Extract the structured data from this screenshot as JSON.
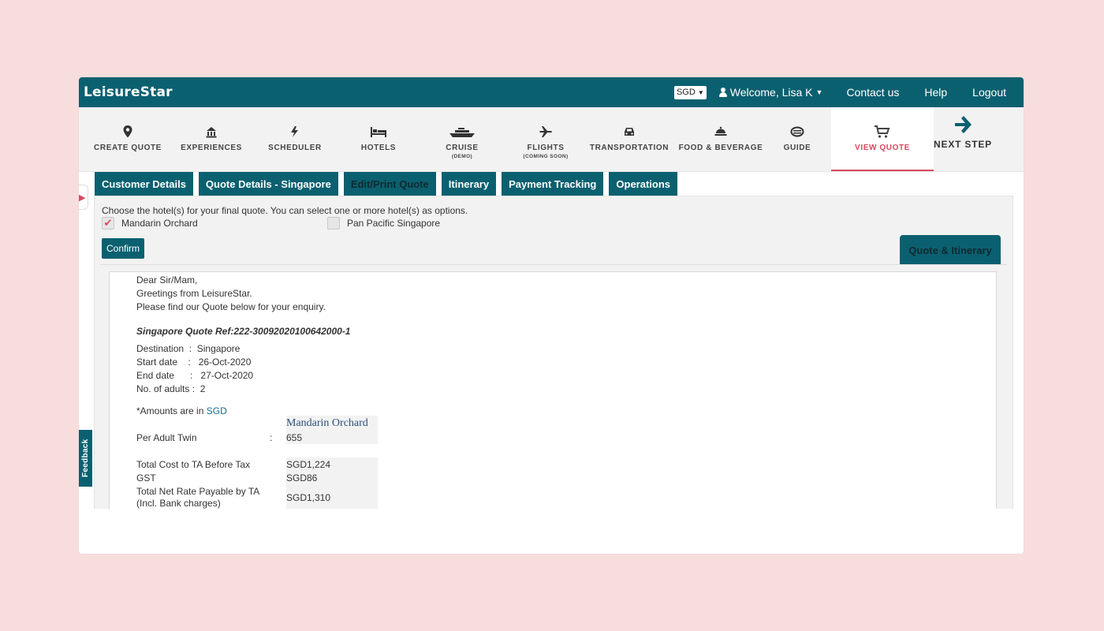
{
  "header": {
    "brand": "LeisureStar",
    "currency": "SGD",
    "welcome": "Welcome, Lisa K",
    "links": [
      "Contact us",
      "Help",
      "Logout"
    ]
  },
  "nav": {
    "items": [
      {
        "label": "CREATE QUOTE",
        "sub": "",
        "icon": "map-pin-icon"
      },
      {
        "label": "EXPERIENCES",
        "sub": "",
        "icon": "landmark-icon"
      },
      {
        "label": "SCHEDULER",
        "sub": "",
        "icon": "bolt-icon"
      },
      {
        "label": "HOTELS",
        "sub": "",
        "icon": "bed-icon"
      },
      {
        "label": "CRUISE",
        "sub": "(DEMO)",
        "icon": "ship-icon"
      },
      {
        "label": "FLIGHTS",
        "sub": "(COMING SOON)",
        "icon": "plane-icon"
      },
      {
        "label": "TRANSPORTATION",
        "sub": "",
        "icon": "car-icon"
      },
      {
        "label": "FOOD & BEVERAGE",
        "sub": "",
        "icon": "food-icon"
      },
      {
        "label": "GUIDE",
        "sub": "",
        "icon": "guide-icon"
      },
      {
        "label": "VIEW QUOTE",
        "sub": "",
        "icon": "cart-icon"
      }
    ],
    "next_step": "NEXT STEP"
  },
  "side": {
    "feedback": "Feedback"
  },
  "tabs": [
    "Customer Details",
    "Quote Details - Singapore",
    "Edit/Print Quote",
    "Itinerary",
    "Payment Tracking",
    "Operations"
  ],
  "selection": {
    "instruction": "Choose the hotel(s) for your final quote. You can select one or more hotel(s) as options.",
    "options": [
      {
        "label": "Mandarin Orchard",
        "checked": true
      },
      {
        "label": "Pan Pacific Singapore",
        "checked": false
      }
    ],
    "confirm": "Confirm",
    "quote_itinerary_tab": "Quote & Itinerary"
  },
  "letter": {
    "greeting": "Dear Sir/Mam,",
    "line2": "Greetings from LeisureStar.",
    "line3": "Please find our Quote below for your enquiry.",
    "ref": "Singapore Quote Ref:222-30092020100642000-1",
    "destination_label": "Destination",
    "destination": "Singapore",
    "start_label": "Start date",
    "start": "26-Oct-2020",
    "end_label": "End date",
    "end": "27-Oct-2020",
    "adults_label": "No. of adults",
    "adults": "2",
    "amounts_prefix": "*Amounts are in",
    "amounts_currency": "SGD",
    "hotel_header": "Mandarin Orchard",
    "per_adult_label": "Per Adult Twin",
    "per_adult_value": "655",
    "total_before_tax_label": "Total Cost to TA Before Tax",
    "total_before_tax_value": "SGD1,224",
    "gst_label": "GST",
    "gst_value": "SGD86",
    "net_label_1": "Total Net Rate Payable by TA",
    "net_label_2": "(Incl. Bank charges)",
    "net_value": "SGD1,310"
  },
  "colors": {
    "primary": "#0b6070",
    "accent": "#d9485f",
    "background": "#f7dedd"
  }
}
